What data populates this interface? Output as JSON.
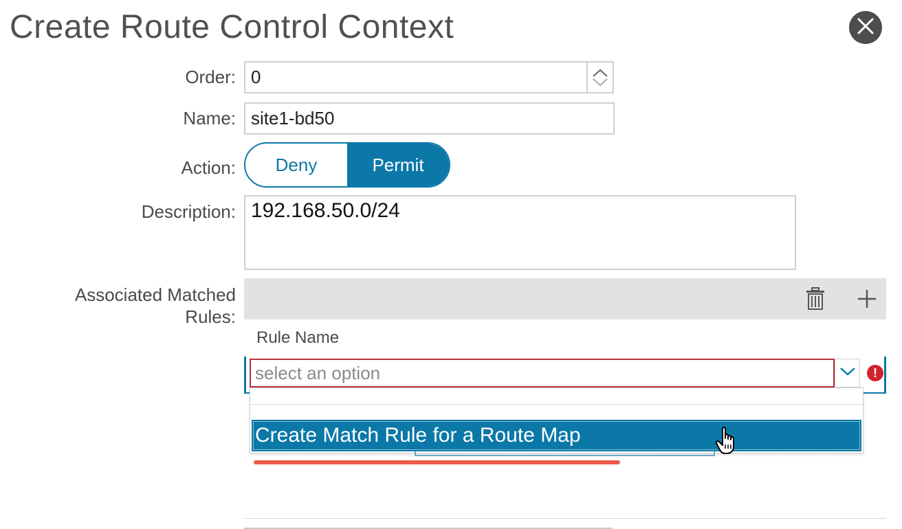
{
  "dialog": {
    "title": "Create Route Control Context",
    "close_icon": "close-icon"
  },
  "form": {
    "order": {
      "label": "Order:",
      "value": "0"
    },
    "name": {
      "label": "Name:",
      "value": "site1-bd50"
    },
    "action": {
      "label": "Action:",
      "options": [
        "Deny",
        "Permit"
      ],
      "selected": "Permit"
    },
    "description": {
      "label": "Description:",
      "value": "192.168.50.0/24"
    },
    "matched_rules": {
      "label_line1": "Associated Matched",
      "label_line2": "Rules:",
      "toolbar_icons": [
        "trash-icon",
        "plus-icon"
      ],
      "column_header": "Rule Name",
      "select": {
        "placeholder": "select an option",
        "dropdown_options": [
          "Create Match Rule for a Route Map"
        ],
        "error_icon": "exclamation-icon"
      }
    }
  },
  "colors": {
    "accent": "#0b78a8",
    "error": "#d0232f",
    "highlight_underline": "#ef5a4d"
  }
}
